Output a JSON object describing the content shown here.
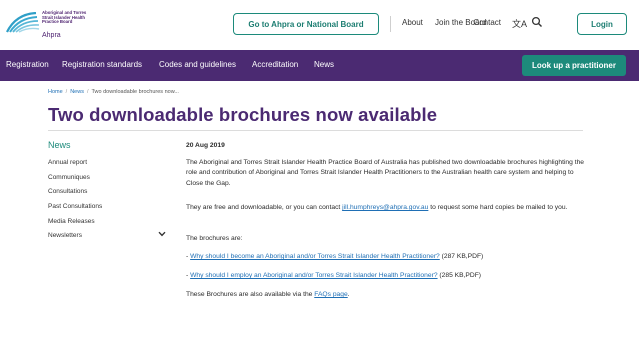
{
  "header": {
    "logo_lines": [
      "Aboriginal and Torres",
      "Strait Islander Health",
      "Practice Board"
    ],
    "logo_ahpra": "Ahpra",
    "board_button": "Go to Ahpra or National Board",
    "top_links": [
      "About",
      "Join the Board",
      "Contact"
    ],
    "login_button": "Login",
    "icons": {
      "language": "translate-icon",
      "search": "search-icon"
    }
  },
  "nav": {
    "items": [
      "Registration",
      "Registration standards",
      "Codes and guidelines",
      "Accreditation",
      "News"
    ],
    "lookup_button": "Look up a practitioner"
  },
  "breadcrumb": [
    "Home",
    "News",
    "Two downloadable brochures now..."
  ],
  "page_title": "Two downloadable brochures now available",
  "sidebar": {
    "heading": "News",
    "items": [
      "Annual report",
      "Communiques",
      "Consultations",
      "Past Consultations",
      "Media Releases",
      "Newsletters"
    ]
  },
  "article": {
    "date": "20 Aug 2019",
    "p1": "The Aboriginal and Torres Strait Islander Health Practice Board of Australia has published two downloadable brochures highlighting the role and contribution of Aboriginal and Torres Strait Islander Health Practitioners to the Australian health care system and helping to Close the Gap.",
    "p2_before": "They are free and downloadable, or you can contact ",
    "p2_email": "jill.humphreys@ahpra.gov.au",
    "p2_after": " to request some hard copies be mailed to you.",
    "p3": "The brochures are:",
    "b1_prefix": "- ",
    "b1_link": "Why should I become an Aboriginal and/or Torres Strait Islander Health Practitioner?",
    "b1_size": " (287 KB,PDF)",
    "b2_prefix": "- ",
    "b2_link": "Why should I employ an Aboriginal and/or Torres Strait Islander Health Practitioner?",
    "b2_size": "  (285 KB,PDF)",
    "p4_before": "These Brochures are also available via the ",
    "p4_link": "FAQs page",
    "p4_after": "."
  },
  "colors": {
    "purple": "#4b2a72",
    "teal": "#1d8a7b",
    "link": "#1f6fb5"
  }
}
